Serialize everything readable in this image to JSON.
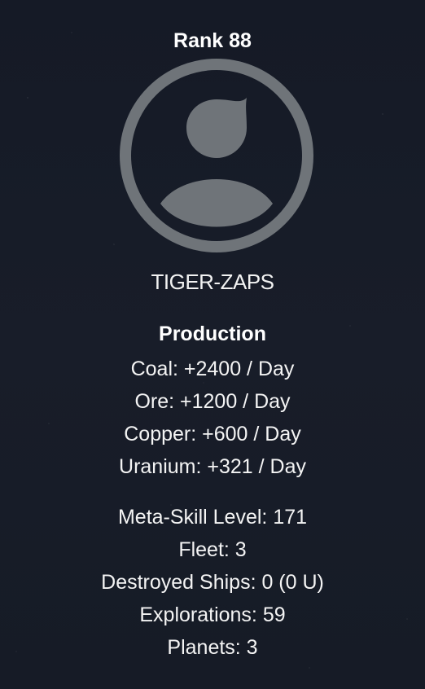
{
  "profile": {
    "rank_label": "Rank 88",
    "username": "TIGER-ZAPS",
    "avatar_icon": "user-avatar-icon",
    "avatar_color": "#6f7479"
  },
  "production": {
    "title": "Production",
    "items": [
      {
        "text": "Coal: +2400 / Day"
      },
      {
        "text": "Ore: +1200 / Day"
      },
      {
        "text": "Copper: +600 / Day"
      },
      {
        "text": "Uranium: +321 / Day"
      }
    ]
  },
  "stats": {
    "items": [
      {
        "text": "Meta-Skill Level: 171"
      },
      {
        "text": "Fleet: 3"
      },
      {
        "text": "Destroyed Ships: 0 (0 U)"
      },
      {
        "text": "Explorations: 59"
      },
      {
        "text": "Planets: 3"
      }
    ]
  },
  "colors": {
    "background": "#161b27",
    "text": "#ffffff",
    "avatar": "#6f7479"
  }
}
